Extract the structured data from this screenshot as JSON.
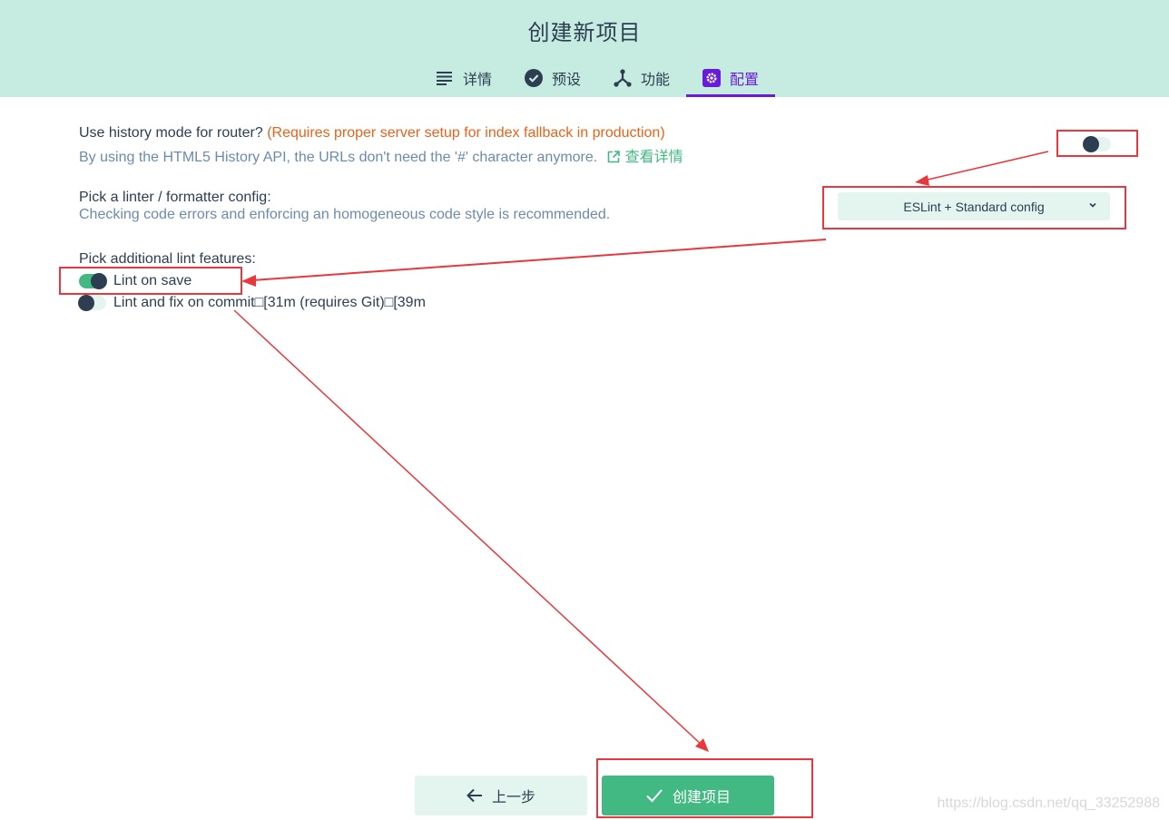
{
  "header": {
    "title": "创建新项目",
    "tabs": [
      {
        "label": "详情",
        "icon": "list-icon",
        "active": false
      },
      {
        "label": "预设",
        "icon": "check-circle-icon",
        "active": false
      },
      {
        "label": "功能",
        "icon": "fork-icon",
        "active": false
      },
      {
        "label": "配置",
        "icon": "gear-icon",
        "active": true
      }
    ]
  },
  "history_mode": {
    "title": "Use history mode for router?",
    "warning": "(Requires proper server setup for index fallback in production)",
    "description": "By using the HTML5 History API, the URLs don't need the '#' character anymore.",
    "more_info": "查看详情",
    "enabled": false
  },
  "linter": {
    "title": "Pick a linter / formatter config:",
    "description": "Checking code errors and enforcing an homogeneous code style is recommended.",
    "selected": "ESLint + Standard config"
  },
  "lint_features": {
    "title": "Pick additional lint features:",
    "options": [
      {
        "label": "Lint on save",
        "checked": true
      },
      {
        "label": "Lint and fix on commit□[31m (requires Git)□[39m",
        "checked": false
      }
    ]
  },
  "footer": {
    "prev_label": "上一步",
    "create_label": "创建项目"
  },
  "watermark": "https://blog.csdn.net/qq_33252988",
  "colors": {
    "header_bg": "#c6ebe0",
    "accent_green": "#42b983",
    "active_tab": "#6a1bd8",
    "warning": "#e8621a",
    "annotation_red": "#e8383d"
  }
}
